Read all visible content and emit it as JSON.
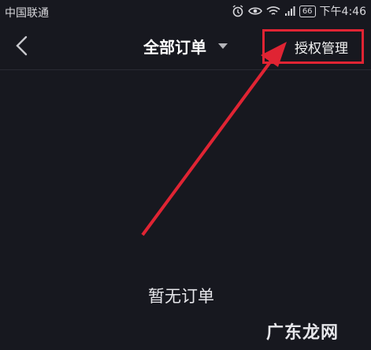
{
  "status_bar": {
    "carrier": "中国联通",
    "battery": "66",
    "time": "下午4:46"
  },
  "navbar": {
    "title": "全部订单",
    "authorize_label": "授权管理"
  },
  "main": {
    "empty_text": "暂无订单"
  },
  "watermark": "广东龙网",
  "colors": {
    "background": "#17181f",
    "annotation_red": "#e02433"
  }
}
